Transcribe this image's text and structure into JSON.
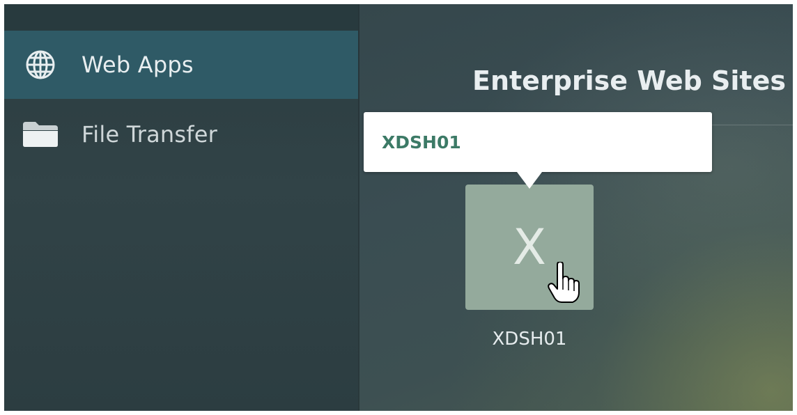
{
  "sidebar": {
    "items": [
      {
        "label": "Web Apps",
        "icon": "globe-icon",
        "active": true
      },
      {
        "label": "File Transfer",
        "icon": "folder-icon",
        "active": false
      }
    ]
  },
  "main": {
    "section_title": "Enterprise Web Sites",
    "apps": [
      {
        "name": "XDSH01",
        "tile_letter": "X",
        "tile_color": "#94aa9c"
      }
    ],
    "tooltip": {
      "text": "XDSH01"
    }
  },
  "colors": {
    "active_item_bg": "#2f5a66",
    "tooltip_text": "#3c7a66",
    "tile": "#94aa9c"
  }
}
